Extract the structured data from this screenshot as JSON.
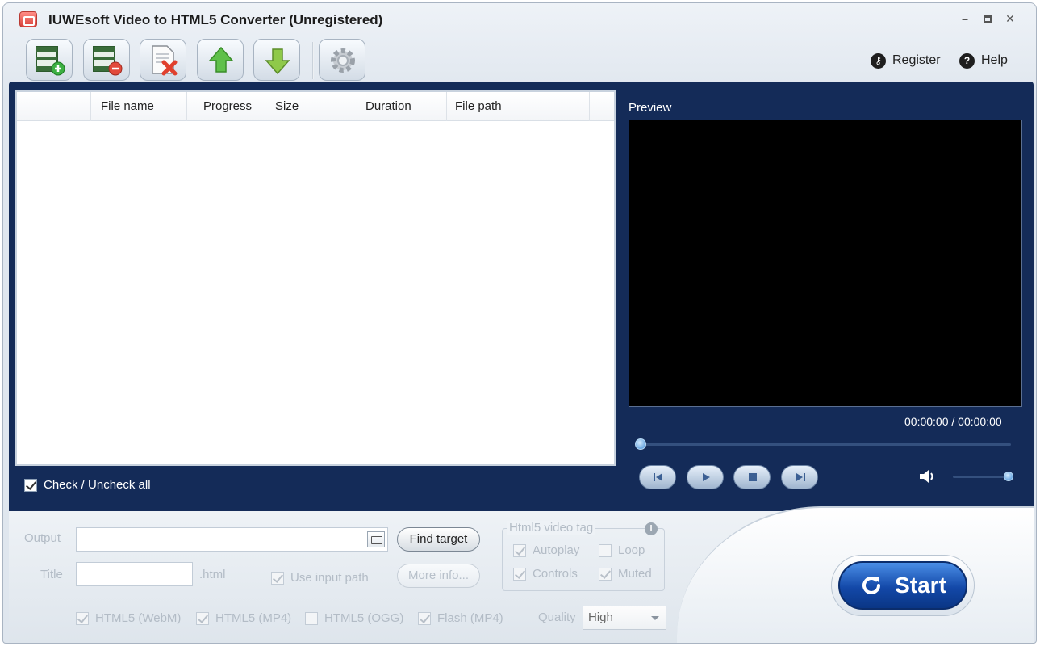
{
  "window": {
    "title": "IUWEsoft Video to HTML5 Converter (Unregistered)",
    "controls": [
      "minimize",
      "maximize",
      "close"
    ]
  },
  "toolbar": {
    "buttons": [
      {
        "icon": "add-video-icon"
      },
      {
        "icon": "remove-video-icon"
      },
      {
        "icon": "clear-list-icon"
      },
      {
        "icon": "move-up-icon"
      },
      {
        "icon": "move-down-icon"
      },
      {
        "icon": "settings-gear-icon"
      }
    ],
    "register_label": "Register",
    "help_label": "Help"
  },
  "file_list": {
    "columns": [
      "",
      "File name",
      "Progress",
      "Size",
      "Duration",
      "File path"
    ],
    "rows": [],
    "check_all_label": "Check / Uncheck all",
    "check_all_checked": true
  },
  "preview": {
    "label": "Preview",
    "time": "00:00:00 / 00:00:00",
    "seek_position": 0,
    "volume_level": 1.0
  },
  "output": {
    "output_label": "Output",
    "output_value": "",
    "find_target_label": "Find target",
    "title_label": "Title",
    "title_value": "",
    "title_suffix": ".html",
    "use_input_path_label": "Use input path",
    "more_info_label": "More info...",
    "formats": [
      {
        "label": "HTML5 (WebM)",
        "checked": true
      },
      {
        "label": "HTML5 (MP4)",
        "checked": true
      },
      {
        "label": "HTML5 (OGG)",
        "checked": false
      },
      {
        "label": "Flash (MP4)",
        "checked": true
      }
    ],
    "quality_label": "Quality",
    "quality_value": "High"
  },
  "video_tag": {
    "group_label": "Html5 video tag",
    "autoplay_label": "Autoplay",
    "loop_label": "Loop",
    "controls_label": "Controls",
    "muted_label": "Muted"
  },
  "start_label": "Start",
  "colors": {
    "panel_blue": "#142b58",
    "start_blue": "#1348a8"
  }
}
